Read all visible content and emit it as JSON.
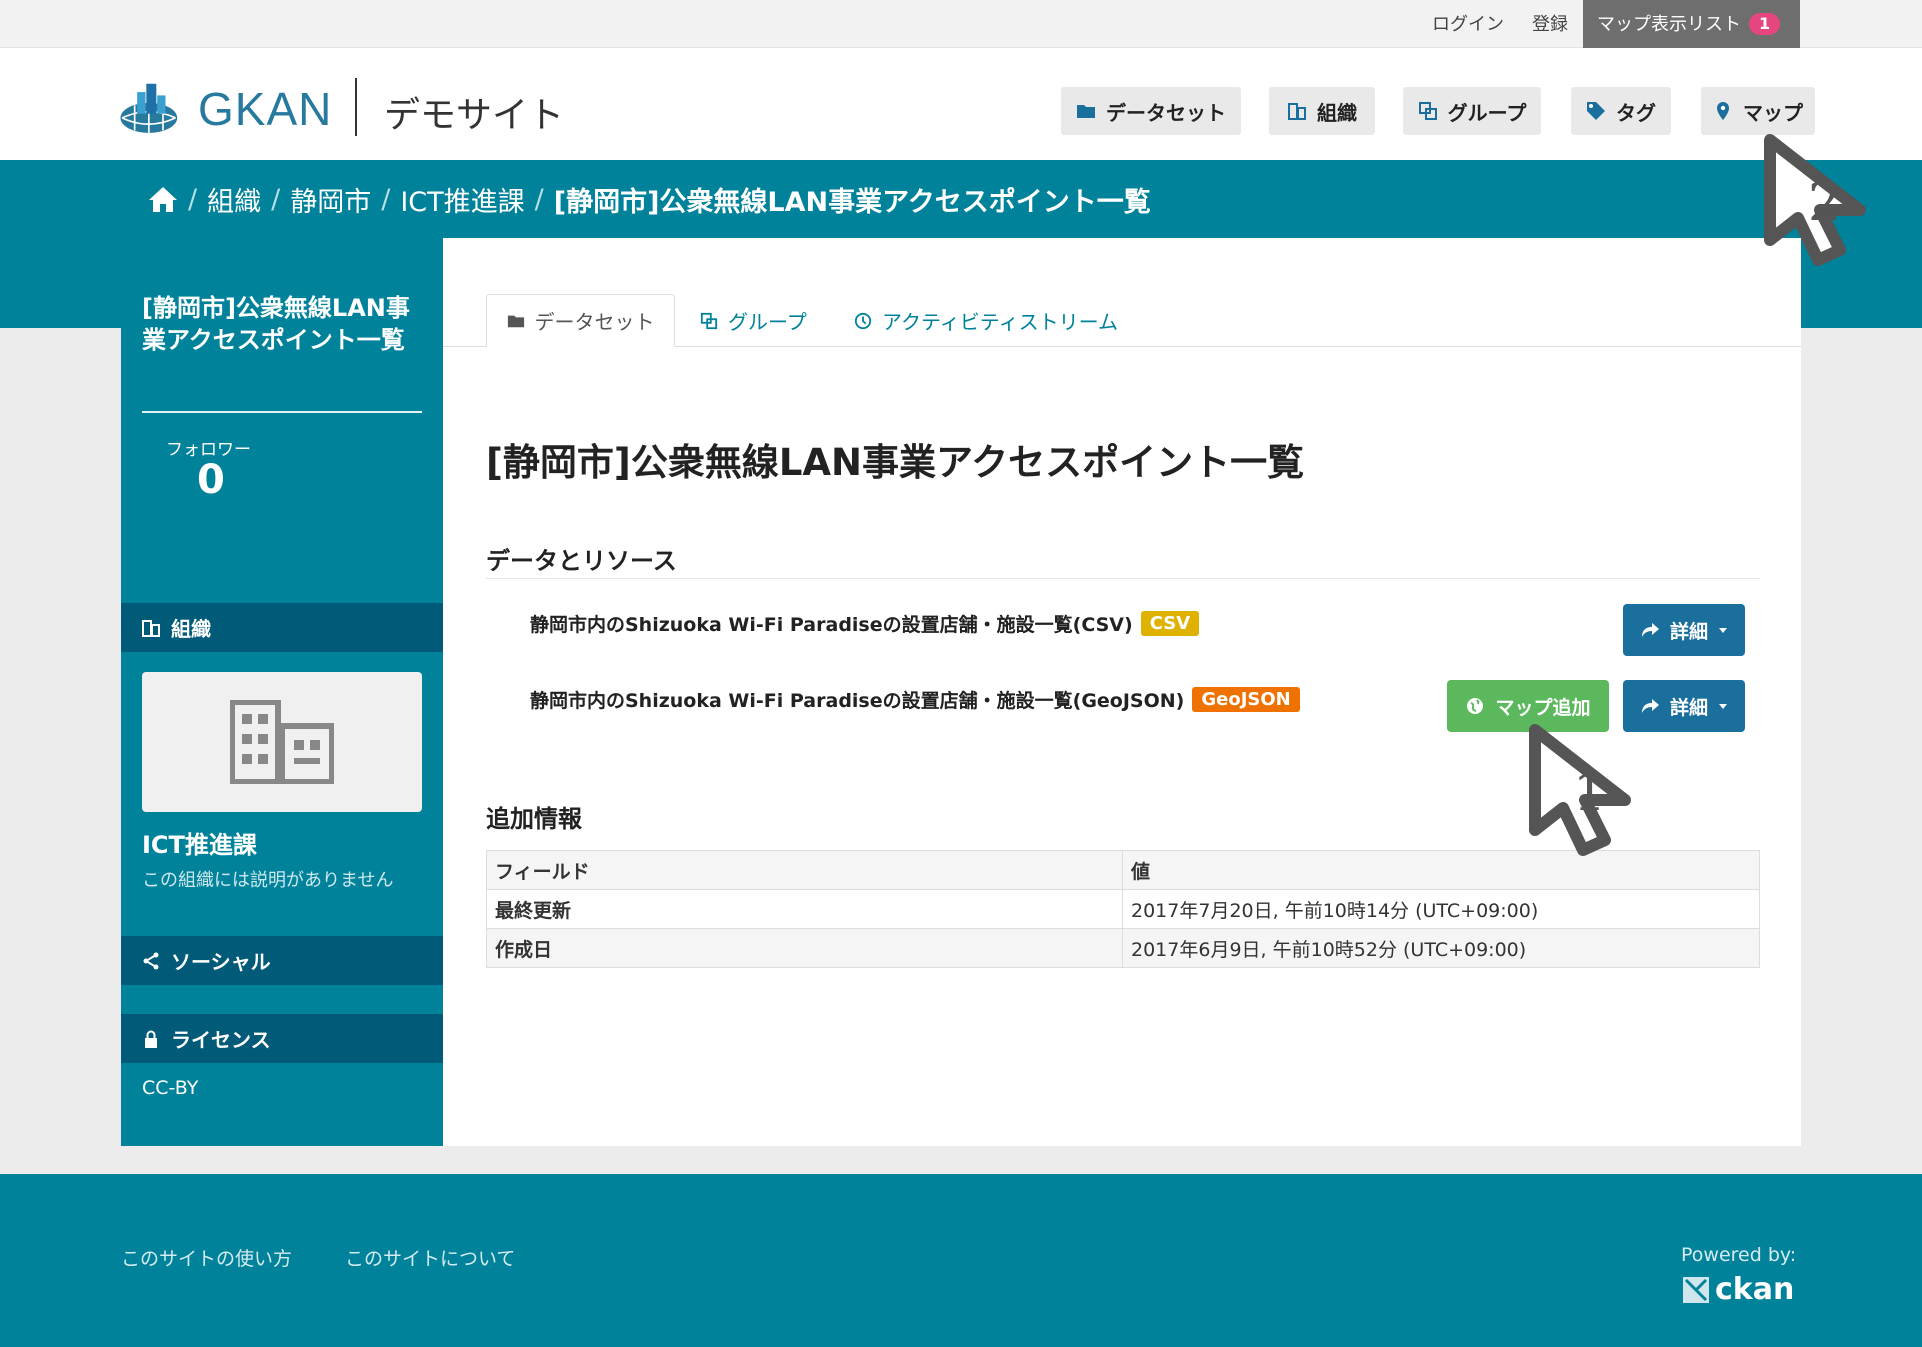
{
  "topbar": {
    "login": "ログイン",
    "register": "登録",
    "map_list": "マップ表示リスト",
    "map_list_count": "1"
  },
  "header": {
    "brand": "GKAN",
    "site_name": "デモサイト",
    "nav": [
      {
        "label": "データセット",
        "icon": "folder-icon"
      },
      {
        "label": "組織",
        "icon": "building-icon"
      },
      {
        "label": "グループ",
        "icon": "group-icon"
      },
      {
        "label": "タグ",
        "icon": "tag-icon"
      },
      {
        "label": "マップ",
        "icon": "map-marker-icon"
      }
    ]
  },
  "breadcrumb": {
    "sep": "/",
    "items": [
      "組織",
      "静岡市",
      "ICT推進課",
      "[静岡市]公衆無線LAN事業アクセスポイント一覧"
    ]
  },
  "sidebar": {
    "title": "[静岡市]公衆無線LAN事業アクセスポイント一覧",
    "followers_label": "フォロワー",
    "followers_count": "0",
    "org_heading": "組織",
    "org_name": "ICT推進課",
    "org_description": "この組織には説明がありません",
    "social_heading": "ソーシャル",
    "license_heading": "ライセンス",
    "license_value": "CC-BY"
  },
  "tabs": [
    "データセット",
    "グループ",
    "アクティビティストリーム"
  ],
  "main": {
    "title": "[静岡市]公衆無線LAN事業アクセスポイント一覧",
    "resources_heading": "データとリソース",
    "resources": [
      {
        "name": "静岡市内のShizuoka Wi-Fi Paradiseの設置店舗・施設一覧(CSV)",
        "format": "CSV",
        "format_color": "#dfb100"
      },
      {
        "name": "静岡市内のShizuoka Wi-Fi Paradiseの設置店舗・施設一覧(GeoJSON)",
        "format": "GeoJSON",
        "format_color": "#ef7100"
      }
    ],
    "detail_label": "詳細",
    "map_add_label": "マップ追加",
    "additional_heading": "追加情報",
    "table": {
      "headers": [
        "フィールド",
        "値"
      ],
      "rows": [
        [
          "最終更新",
          "2017年7月20日, 午前10時14分 (UTC+09:00)"
        ],
        [
          "作成日",
          "2017年6月9日, 午前10時52分 (UTC+09:00)"
        ]
      ]
    }
  },
  "annotations": {
    "cursor1": "1",
    "cursor2": "2"
  },
  "footer": {
    "link1": "このサイトの使い方",
    "link2": "このサイトについて",
    "powered_by": "Powered by:",
    "ckan": "ckan"
  }
}
